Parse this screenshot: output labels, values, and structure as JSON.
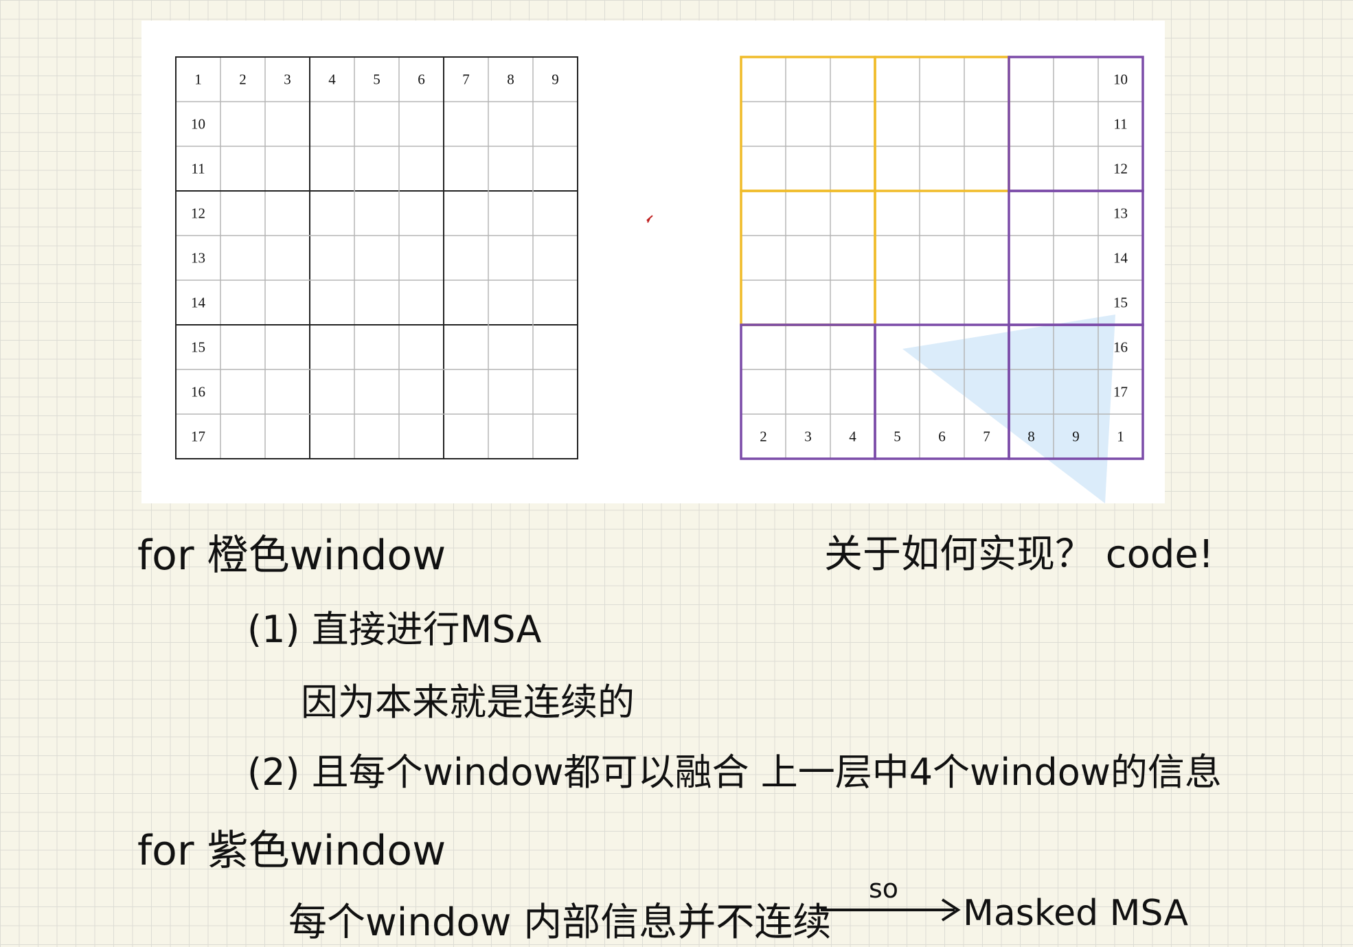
{
  "left_grid": {
    "top_row": [
      "1",
      "2",
      "3",
      "4",
      "5",
      "6",
      "7",
      "8",
      "9"
    ],
    "left_col": [
      "10",
      "11",
      "12",
      "13",
      "14",
      "15",
      "16",
      "17"
    ]
  },
  "right_grid": {
    "right_col": [
      "10",
      "11",
      "12",
      "13",
      "14",
      "15",
      "16",
      "17"
    ],
    "bottom_row": [
      "2",
      "3",
      "4",
      "5",
      "6",
      "7",
      "8",
      "9",
      "1"
    ]
  },
  "colors": {
    "orange_window": "#f0bc2a",
    "purple_window": "#7b4ba8",
    "thick_line": "#222222",
    "thin_line": "#b5b5b5",
    "highlight": "#cfe6f8"
  },
  "notes": {
    "line1": "for 橙色window",
    "line1_right": "关于如何实现？ code!",
    "line2": "(1) 直接进行MSA",
    "line3": "因为本来就是连续的",
    "line4": "(2) 且每个window都可以融合 上一层中4个window的信息",
    "line5": "for 紫色window",
    "line6": "每个window 内部信息并不连续",
    "arrow_label": "so",
    "line6_end": "Masked MSA"
  }
}
